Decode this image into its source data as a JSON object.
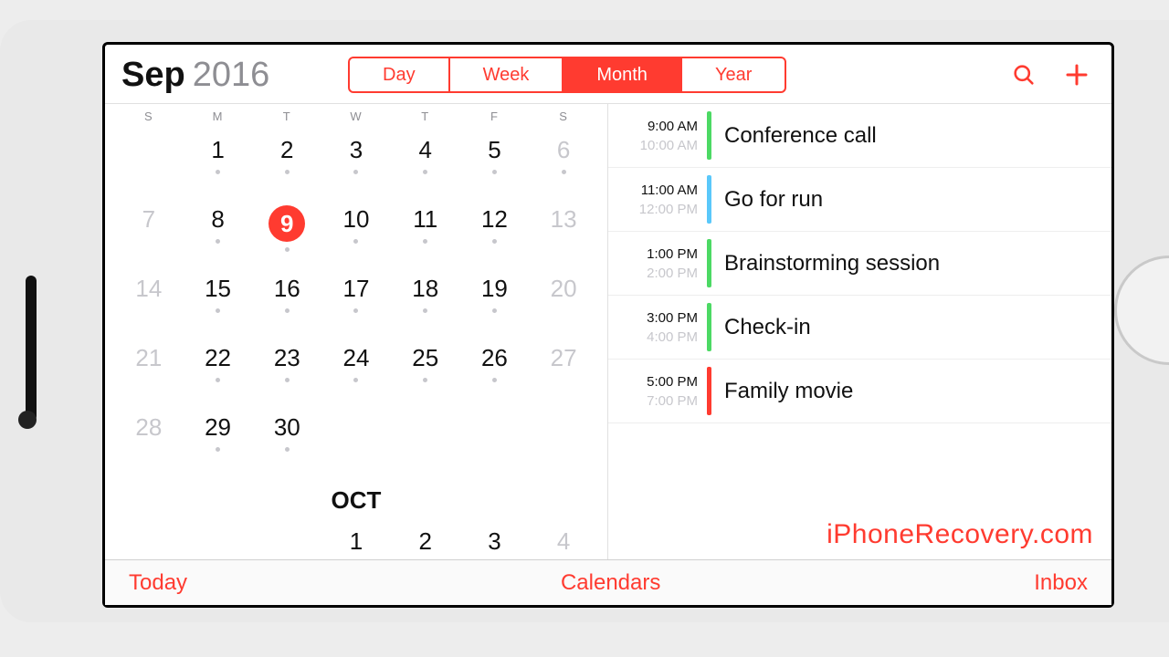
{
  "title": {
    "month": "Sep",
    "year": "2016"
  },
  "segments": {
    "items": [
      "Day",
      "Week",
      "Month",
      "Year"
    ],
    "active_index": 2
  },
  "dow": [
    "S",
    "M",
    "T",
    "W",
    "T",
    "F",
    "S"
  ],
  "weeks": [
    [
      {
        "n": "",
        "dot": false,
        "weekend": true
      },
      {
        "n": "1",
        "dot": true,
        "weekend": false
      },
      {
        "n": "2",
        "dot": true,
        "weekend": false
      },
      {
        "n": "3",
        "dot": true,
        "weekend": false
      },
      {
        "n": "4",
        "dot": true,
        "weekend": false
      },
      {
        "n": "5",
        "dot": true,
        "weekend": false
      },
      {
        "n": "6",
        "dot": true,
        "weekend": true
      }
    ],
    [
      {
        "n": "7",
        "dot": false,
        "weekend": true
      },
      {
        "n": "8",
        "dot": true,
        "weekend": false
      },
      {
        "n": "9",
        "dot": true,
        "weekend": false,
        "selected": true
      },
      {
        "n": "10",
        "dot": true,
        "weekend": false
      },
      {
        "n": "11",
        "dot": true,
        "weekend": false
      },
      {
        "n": "12",
        "dot": true,
        "weekend": false
      },
      {
        "n": "13",
        "dot": false,
        "weekend": true
      }
    ],
    [
      {
        "n": "14",
        "dot": false,
        "weekend": true
      },
      {
        "n": "15",
        "dot": true,
        "weekend": false
      },
      {
        "n": "16",
        "dot": true,
        "weekend": false
      },
      {
        "n": "17",
        "dot": true,
        "weekend": false
      },
      {
        "n": "18",
        "dot": true,
        "weekend": false
      },
      {
        "n": "19",
        "dot": true,
        "weekend": false
      },
      {
        "n": "20",
        "dot": false,
        "weekend": true
      }
    ],
    [
      {
        "n": "21",
        "dot": false,
        "weekend": true
      },
      {
        "n": "22",
        "dot": true,
        "weekend": false
      },
      {
        "n": "23",
        "dot": true,
        "weekend": false
      },
      {
        "n": "24",
        "dot": true,
        "weekend": false
      },
      {
        "n": "25",
        "dot": true,
        "weekend": false
      },
      {
        "n": "26",
        "dot": true,
        "weekend": false
      },
      {
        "n": "27",
        "dot": false,
        "weekend": true
      }
    ],
    [
      {
        "n": "28",
        "dot": false,
        "weekend": true
      },
      {
        "n": "29",
        "dot": true,
        "weekend": false
      },
      {
        "n": "30",
        "dot": true,
        "weekend": false
      },
      {
        "n": "",
        "dot": false,
        "weekend": false
      },
      {
        "n": "",
        "dot": false,
        "weekend": false
      },
      {
        "n": "",
        "dot": false,
        "weekend": false
      },
      {
        "n": "",
        "dot": false,
        "weekend": true
      }
    ]
  ],
  "next_month": {
    "label": "OCT",
    "days": [
      "",
      "",
      "",
      "1",
      "2",
      "3",
      "4"
    ]
  },
  "events": [
    {
      "start": "9:00 AM",
      "end": "10:00 AM",
      "title": "Conference call",
      "color": "#4cd964"
    },
    {
      "start": "11:00 AM",
      "end": "12:00 PM",
      "title": "Go for run",
      "color": "#5ac8fa"
    },
    {
      "start": "1:00 PM",
      "end": "2:00 PM",
      "title": "Brainstorming session",
      "color": "#4cd964"
    },
    {
      "start": "3:00 PM",
      "end": "4:00 PM",
      "title": "Check-in",
      "color": "#4cd964"
    },
    {
      "start": "5:00 PM",
      "end": "7:00 PM",
      "title": "Family movie",
      "color": "#ff3b30"
    }
  ],
  "watermark": "iPhoneRecovery.com",
  "bottombar": {
    "today": "Today",
    "calendars": "Calendars",
    "inbox": "Inbox"
  },
  "accent": "#ff3b30"
}
